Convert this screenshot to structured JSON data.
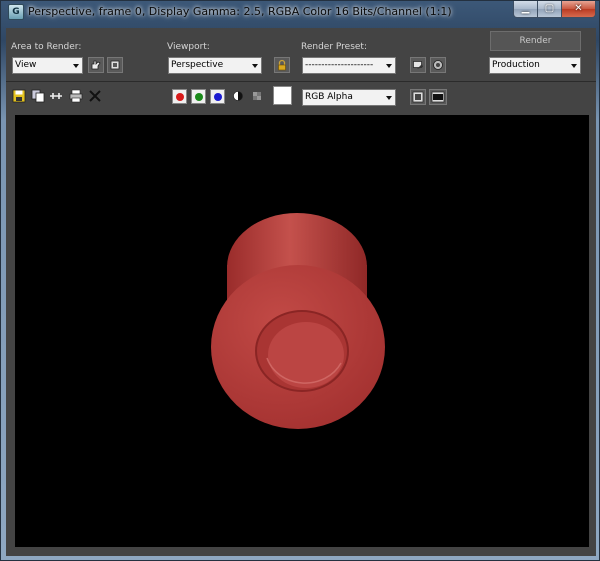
{
  "window": {
    "app_icon_letter": "G",
    "title": "Perspective, frame 0, Display Gamma: 2.5, RGBA Color 16 Bits/Channel (1:1)"
  },
  "controls": {
    "area_label": "Area to Render:",
    "area_value": "View",
    "viewport_label": "Viewport:",
    "viewport_value": "Perspective",
    "preset_label": "Render Preset:",
    "preset_value": "---------------------",
    "render_label": "Render",
    "mode_value": "Production"
  },
  "toolbar": {
    "channel_value": "RGB Alpha",
    "red_dot_color": "#d81a1a",
    "green_dot_color": "#1a8a1a",
    "blue_dot_color": "#1a1ad0"
  },
  "render": {
    "background_color": "#000000",
    "object_color": "#b53a38"
  },
  "icons": [
    "app-icon",
    "minimize-icon",
    "maximize-icon",
    "close-icon",
    "region-select-icon",
    "crop-region-icon",
    "lock-icon",
    "render-setup-icon",
    "environment-icon",
    "save-icon",
    "copy-icon",
    "clone-icon",
    "print-icon",
    "clear-icon",
    "mono-icon",
    "checker-icon"
  ]
}
